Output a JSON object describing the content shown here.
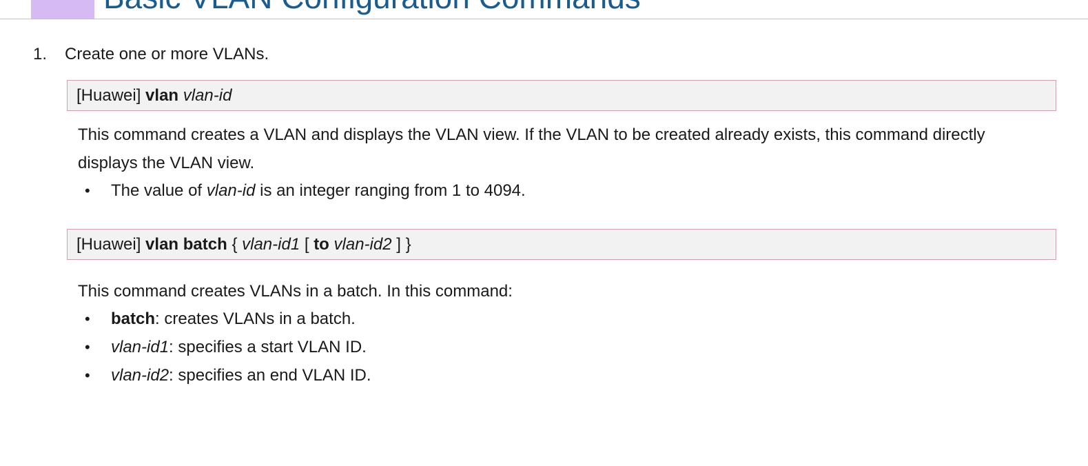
{
  "header": {
    "title": "Basic VLAN Configuration Commands"
  },
  "step": {
    "number": "1.",
    "text": "Create one or more VLANs."
  },
  "command1": {
    "prompt": "[Huawei]",
    "keyword": "vlan",
    "param": "vlan-id"
  },
  "description1": {
    "text": "This command creates a VLAN and displays the VLAN view. If the VLAN to be created already exists, this command directly displays the VLAN view."
  },
  "bullets1": [
    {
      "marker": "•",
      "pre": "The value of ",
      "param": "vlan-id",
      "post": " is an integer ranging from 1 to 4094."
    }
  ],
  "command2": {
    "prompt": "[Huawei]",
    "keyword1": "vlan",
    "keyword2": "batch",
    "open_brace": "{",
    "param1": "vlan-id1",
    "open_bracket": "[",
    "keyword3": "to",
    "param2": "vlan-id2",
    "close_bracket": "]",
    "close_brace": "}"
  },
  "description2": {
    "text": "This command creates VLANs in a batch. In this command:"
  },
  "bullets2": [
    {
      "marker": "•",
      "term": "batch",
      "text": ": creates VLANs in a batch."
    },
    {
      "marker": "•",
      "term": "vlan-id1",
      "text": ": specifies a start VLAN ID."
    },
    {
      "marker": "•",
      "term": "vlan-id2",
      "text": ": specifies an end VLAN ID."
    }
  ],
  "colors": {
    "header_accent": "#d5baf4",
    "header_title": "#1b5c8f",
    "rule": "#dcb5c3",
    "command_bg": "#f2f2f2",
    "command_border": "#cf9fb0"
  }
}
